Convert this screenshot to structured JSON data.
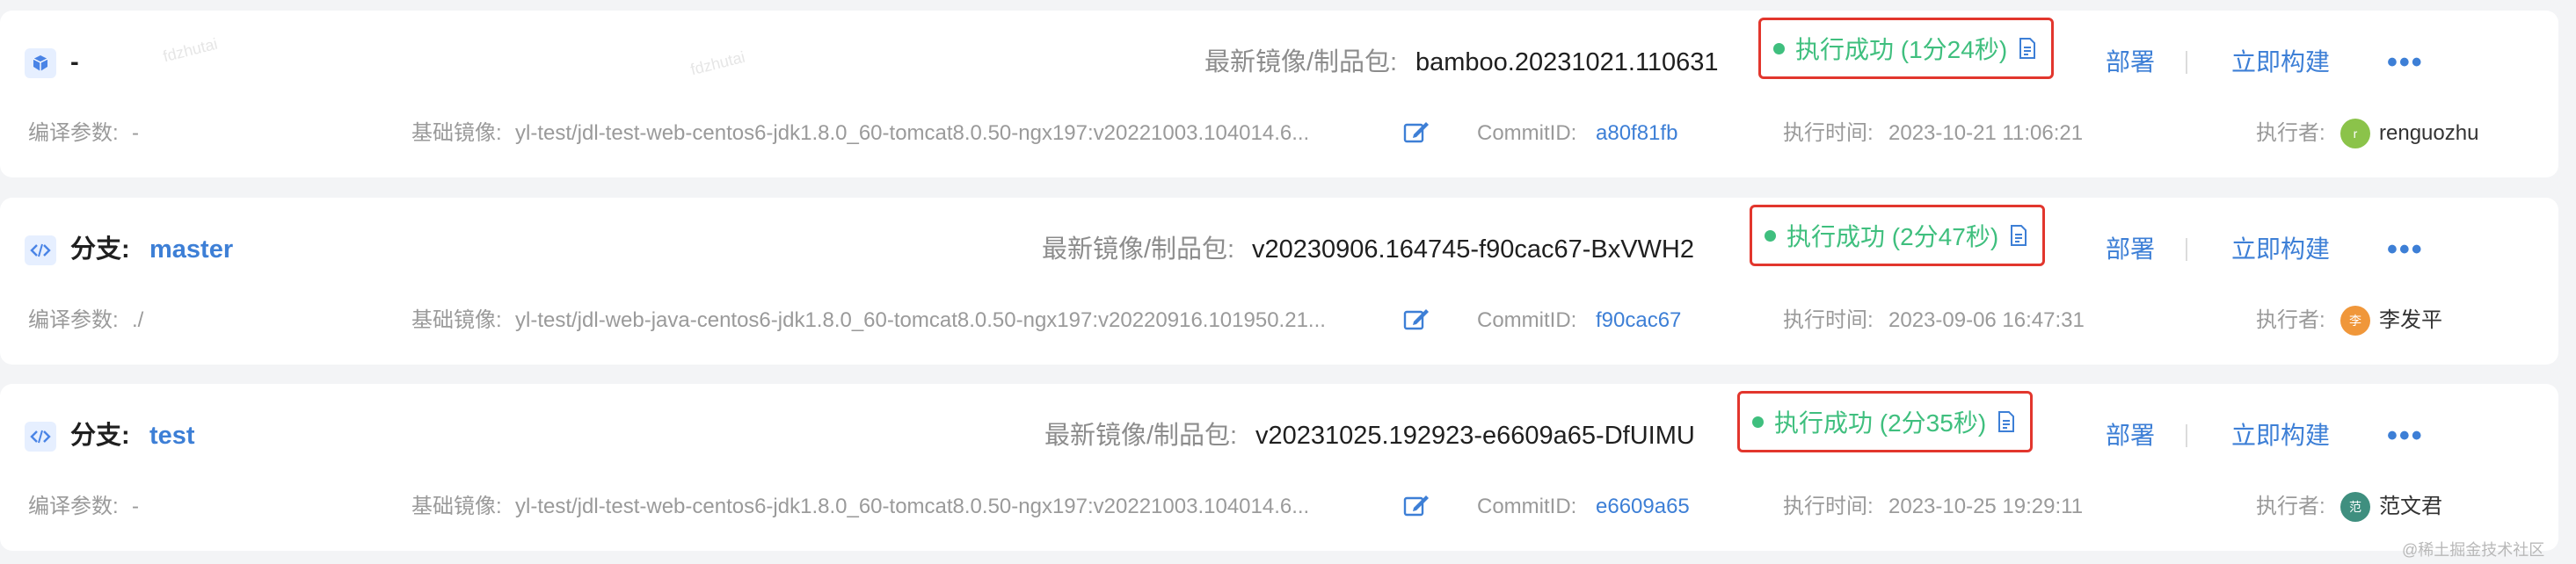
{
  "labels": {
    "artifact": "最新镜像/制品包:",
    "compile_params": "编译参数:",
    "base_image": "基础镜像:",
    "commit": "CommitID:",
    "exec_time": "执行时间:",
    "executor": "执行者:",
    "branch": "分支:",
    "deploy": "部署",
    "build_now": "立即构建",
    "more": "•••"
  },
  "colors": {
    "status_success": "#3fbf7e",
    "link": "#3d7fd6",
    "highlight_border": "#e2362d"
  },
  "cards": [
    {
      "kind": "generic",
      "icon": "cube-icon",
      "title": "-",
      "branch": "",
      "artifact": "bamboo.20231021.110631",
      "status": "执行成功 (1分24秒)",
      "compile_params": "-",
      "base_image": "yl-test/jdl-test-web-centos6-jdk1.8.0_60-tomcat8.0.50-ngx197:v20221003.104014.6...",
      "commit_id": "a80f81fb",
      "exec_time": "2023-10-21 11:06:21",
      "executor": "renguozhu",
      "avatar_text": "r",
      "avatar_color": "#8bc34a"
    },
    {
      "kind": "branch",
      "icon": "code-icon",
      "title": "",
      "branch": "master",
      "artifact": "v20230906.164745-f90cac67-BxVWH2",
      "status": "执行成功 (2分47秒)",
      "compile_params": "./",
      "base_image": "yl-test/jdl-web-java-centos6-jdk1.8.0_60-tomcat8.0.50-ngx197:v20220916.101950.21...",
      "commit_id": "f90cac67",
      "exec_time": "2023-09-06 16:47:31",
      "executor": "李发平",
      "avatar_text": "李",
      "avatar_color": "#f0973a"
    },
    {
      "kind": "branch",
      "icon": "code-icon",
      "title": "",
      "branch": "test",
      "artifact": "v20231025.192923-e6609a65-DfUIMU",
      "status": "执行成功 (2分35秒)",
      "compile_params": "-",
      "base_image": "yl-test/jdl-test-web-centos6-jdk1.8.0_60-tomcat8.0.50-ngx197:v20221003.104014.6...",
      "commit_id": "e6609a65",
      "exec_time": "2023-10-25 19:29:11",
      "executor": "范文君",
      "avatar_text": "范",
      "avatar_color": "#3f8f7f"
    }
  ],
  "watermarks": [
    "fdzhutai",
    "fdzhutai"
  ],
  "footer_mark": "@稀土掘金技术社区"
}
